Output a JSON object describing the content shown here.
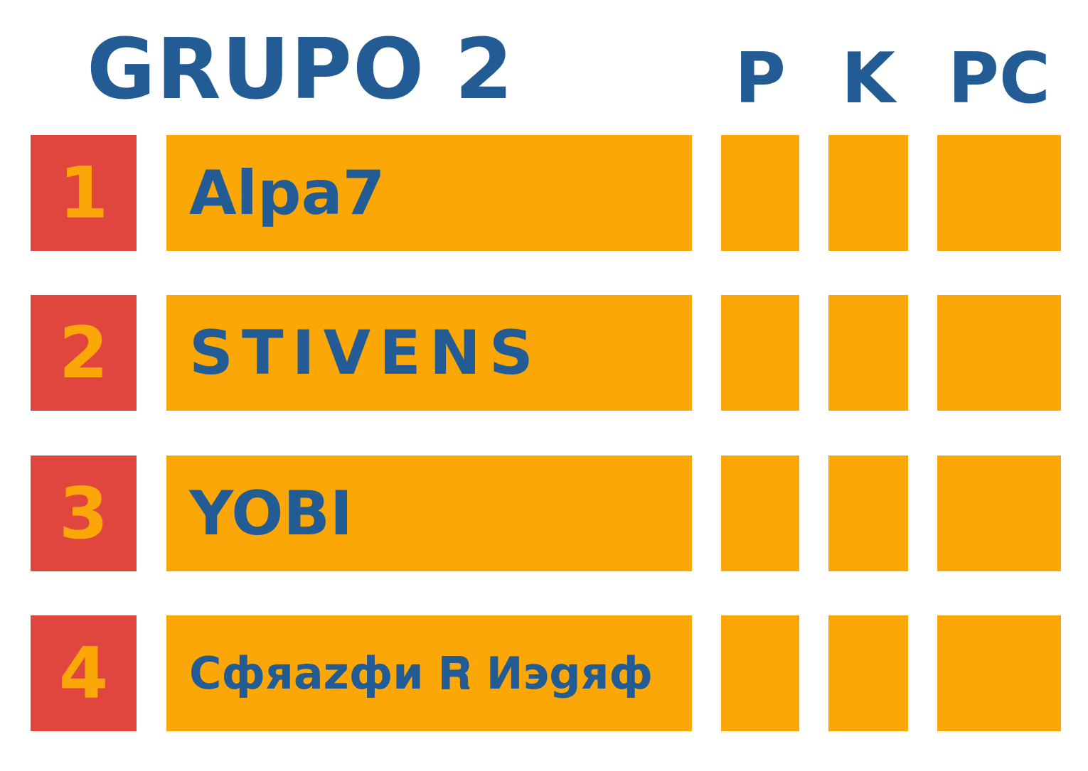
{
  "title": "GRUPO 2",
  "columns": {
    "p": "P",
    "k": "K",
    "pc": "PC"
  },
  "colors": {
    "title": "#235b94",
    "rank_bg": "#e0463d",
    "rank_text": "#fba708",
    "cell_bg": "#fba708"
  },
  "rows": [
    {
      "rank": "1",
      "name": "Alpa7",
      "p": "",
      "k": "",
      "pc": ""
    },
    {
      "rank": "2",
      "name": "STIVENS",
      "p": "",
      "k": "",
      "pc": ""
    },
    {
      "rank": "3",
      "name": "YOBI",
      "p": "",
      "k": "",
      "pc": ""
    },
    {
      "rank": "4",
      "name": "Сфяаzфи 𝐑 Иэgяф",
      "p": "",
      "k": "",
      "pc": ""
    }
  ]
}
